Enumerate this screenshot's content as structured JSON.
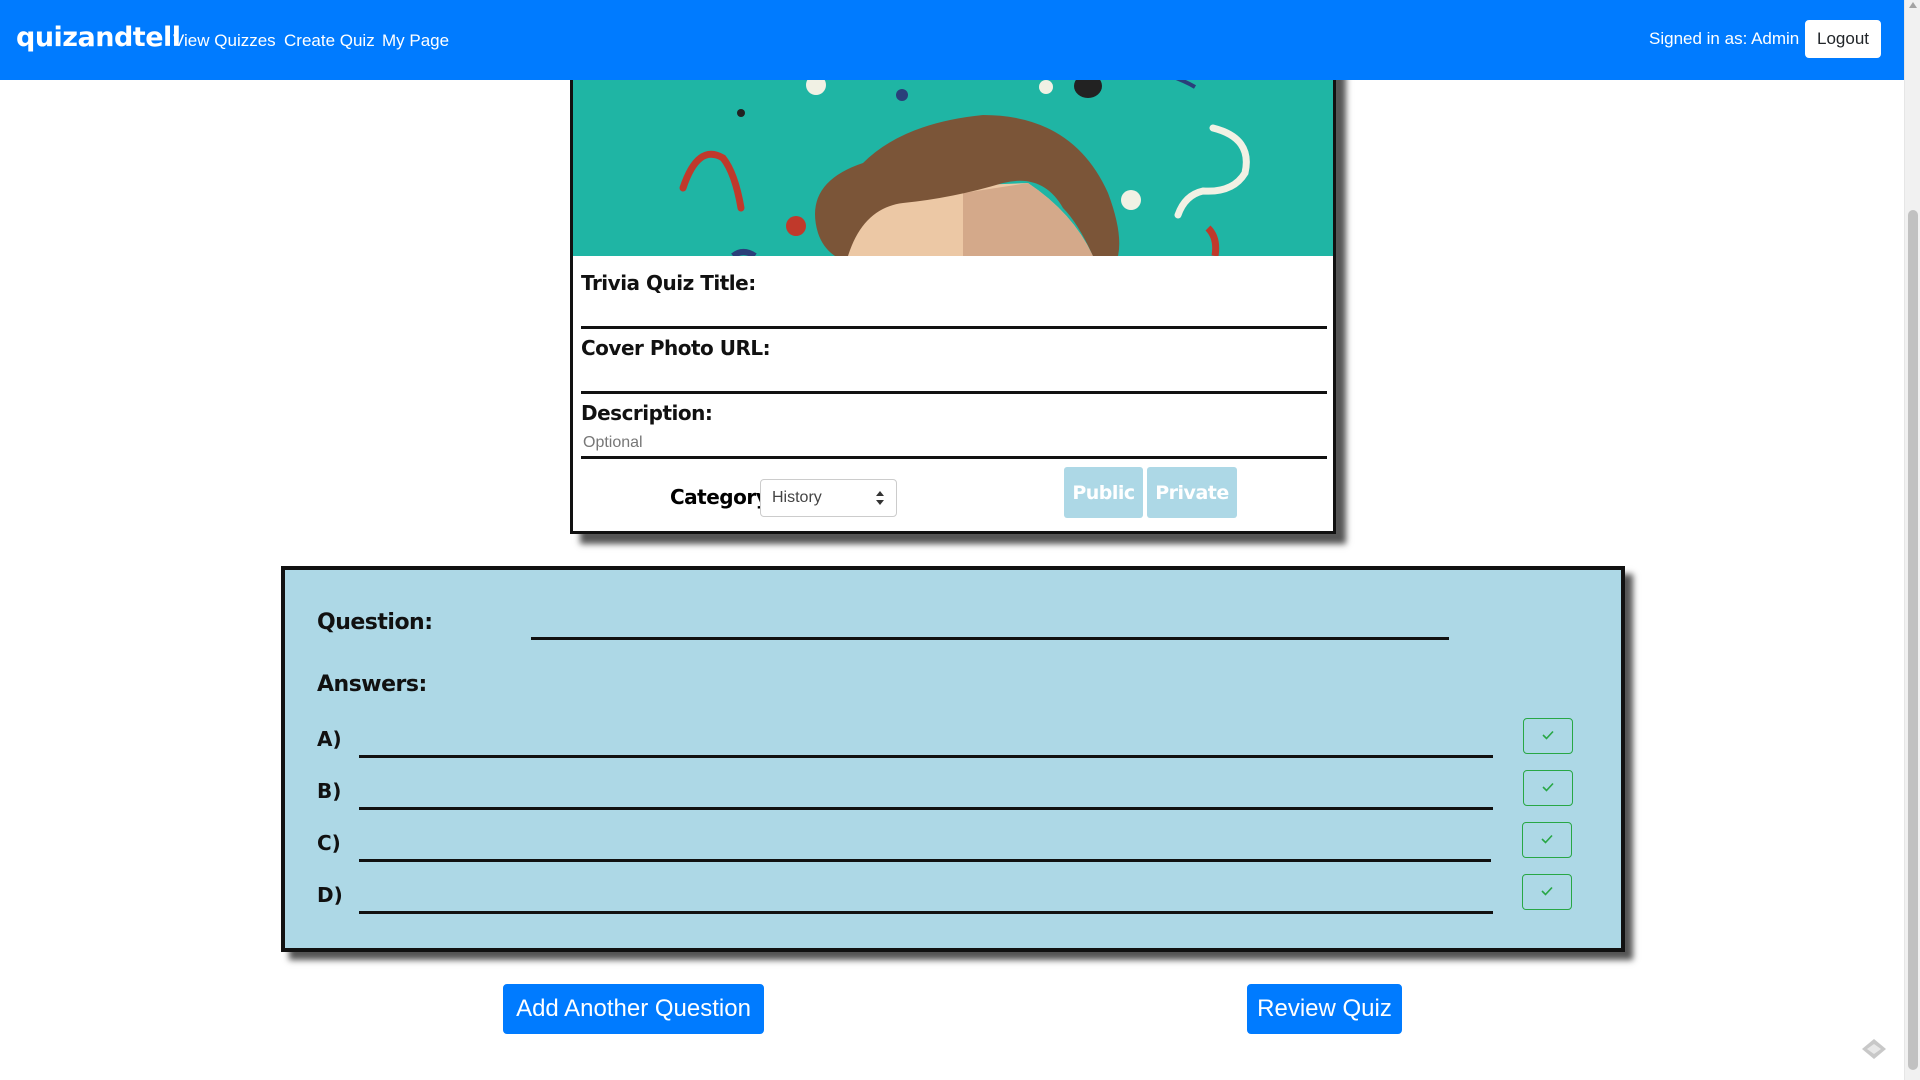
{
  "navbar": {
    "brand": "quizandtell",
    "links": [
      "View Quizzes",
      "Create Quiz",
      "My Page"
    ],
    "signed_in": "Signed in as: Admin",
    "logout": "Logout",
    "color": "#007bff"
  },
  "quiz_form": {
    "title_label": "Trivia Quiz Title:",
    "title_value": "",
    "cover_label": "Cover Photo URL:",
    "cover_value": "",
    "description_label": "Description:",
    "description_placeholder": "Optional",
    "category_label": "Category:",
    "category_selected": "History",
    "public_label": "Public",
    "private_label": "Private",
    "visibility_color": "#add8e6"
  },
  "question_card": {
    "question_label": "Question:",
    "question_value": "",
    "answers_label": "Answers:",
    "options": [
      {
        "letter": "A)",
        "value": ""
      },
      {
        "letter": "B)",
        "value": ""
      },
      {
        "letter": "C)",
        "value": ""
      },
      {
        "letter": "D)",
        "value": ""
      }
    ],
    "background": "#add8e6",
    "check_color": "#28a745"
  },
  "actions": {
    "add_question": "Add Another Question",
    "review_quiz": "Review Quiz"
  }
}
